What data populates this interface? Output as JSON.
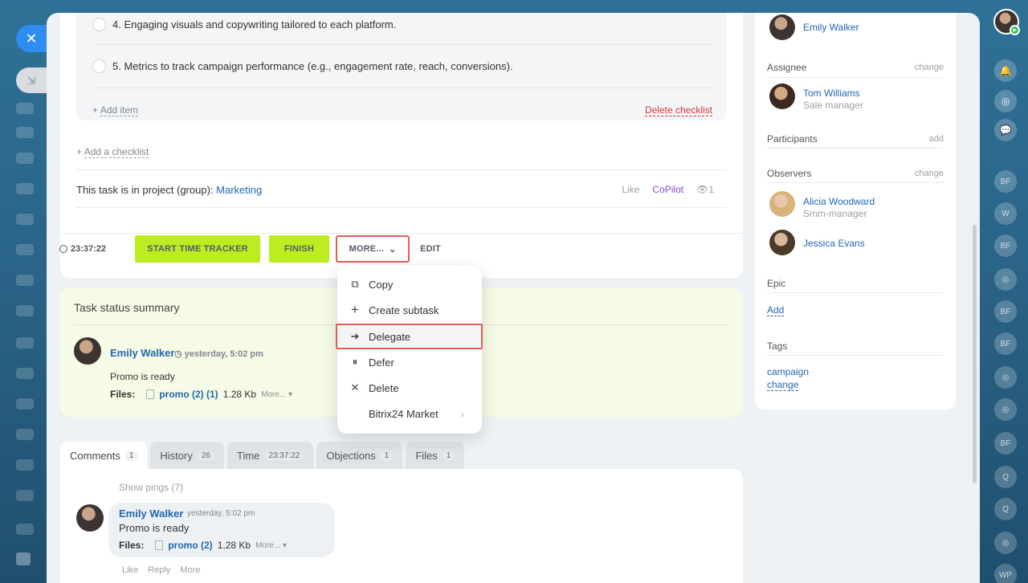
{
  "checklist": {
    "items": [
      "4. Engaging visuals and copywriting tailored to each platform.",
      "5. Metrics to track campaign performance (e.g., engagement rate, reach, conversions)."
    ],
    "add_item": "Add item",
    "delete_checklist": "Delete checklist",
    "add_checklist": "Add a checklist"
  },
  "project": {
    "prefix": "This task is in project (group):",
    "name": "Marketing",
    "like": "Like",
    "copilot": "CoPilot",
    "views": "1"
  },
  "toolbar": {
    "timer": "23:37:22",
    "start_tracker": "START TIME TRACKER",
    "finish": "FINISH",
    "more": "MORE...",
    "edit": "EDIT"
  },
  "more_menu": {
    "items": [
      {
        "label": "Copy",
        "icon": "copy-icon"
      },
      {
        "label": "Create subtask",
        "icon": "plus-icon"
      },
      {
        "label": "Delegate",
        "icon": "delegate-icon"
      },
      {
        "label": "Defer",
        "icon": "pause-icon"
      },
      {
        "label": "Delete",
        "icon": "close-icon"
      },
      {
        "label": "Bitrix24 Market",
        "icon": "chevron-right-icon"
      }
    ]
  },
  "summary": {
    "title": "Task status summary",
    "author": "Emily Walker",
    "time": "yesterday, 5:02 pm",
    "text": "Promo is ready",
    "files_label": "Files:",
    "file_name": "promo (2) (1)",
    "file_size": "1.28 Kb",
    "more": "More..."
  },
  "tabs": [
    {
      "label": "Comments",
      "count": "1"
    },
    {
      "label": "History",
      "count": "26"
    },
    {
      "label": "Time",
      "count": "23:37:22"
    },
    {
      "label": "Objections",
      "count": "1"
    },
    {
      "label": "Files",
      "count": "1"
    }
  ],
  "comments": {
    "show_pings": "Show pings (7)",
    "author": "Emily Walker",
    "time": "yesterday, 5:02 pm",
    "text": "Promo is ready",
    "files_label": "Files:",
    "file_name": "promo (2)",
    "file_size": "1.28 Kb",
    "more": "More...",
    "actions": [
      "Like",
      "Reply",
      "More"
    ]
  },
  "sidebar": {
    "creator": "Emily Walker",
    "assignee_label": "Assignee",
    "assignee_change": "change",
    "assignee_name": "Tom Williams",
    "assignee_role": "Sale manager",
    "participants_label": "Participants",
    "participants_add": "add",
    "observers_label": "Observers",
    "observers_change": "change",
    "observers": [
      {
        "name": "Alicia Woodward",
        "role": "Smm-manager"
      },
      {
        "name": "Jessica Evans",
        "role": ""
      }
    ],
    "epic_label": "Epic",
    "epic_add": "Add",
    "tags_label": "Tags",
    "tag": "campaign",
    "tag_change": "change"
  },
  "right_rail": [
    "BF",
    "W",
    "BF",
    "BF",
    "BF",
    "BF",
    "Q",
    "Q",
    "WP"
  ],
  "colors": {
    "accent_green": "#bbed21",
    "link_blue": "#2067b0",
    "highlight_red": "#e85d52",
    "copilot_purple": "#8b47d9"
  }
}
